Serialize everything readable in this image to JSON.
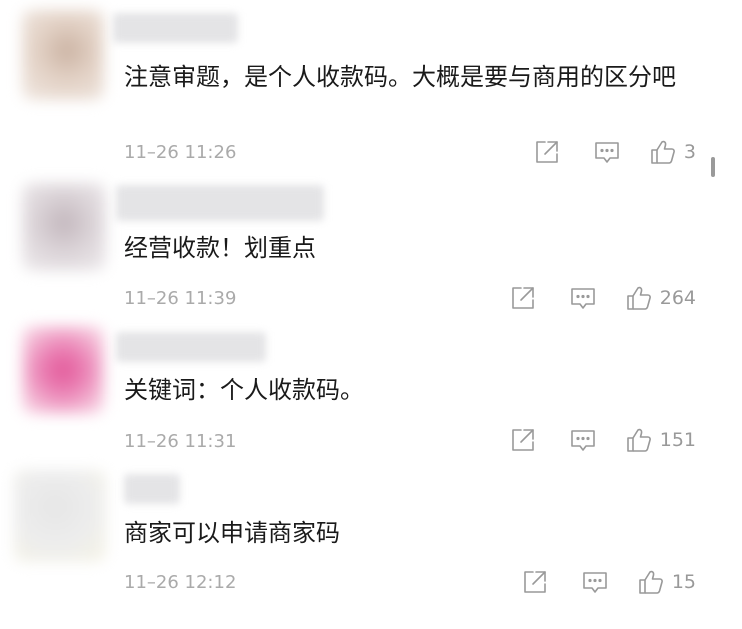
{
  "comments": [
    {
      "text": "注意审题，是个人收款码。大概是要与商用的区分吧",
      "time": "11–26 11:26",
      "likes": "3"
    },
    {
      "text": "经营收款！划重点",
      "time": "11–26 11:39",
      "likes": "264"
    },
    {
      "text": "关键词：个人收款码。",
      "time": "11–26 11:31",
      "likes": "151"
    },
    {
      "text": "商家可以申请商家码",
      "time": "11–26 12:12",
      "likes": "15"
    }
  ],
  "icons": {
    "share": "share-icon",
    "reply": "reply-icon",
    "like": "thumbs-up-icon"
  },
  "colors": {
    "text": "#1a1a1a",
    "meta": "#aaaaaa",
    "icon": "#999999"
  }
}
